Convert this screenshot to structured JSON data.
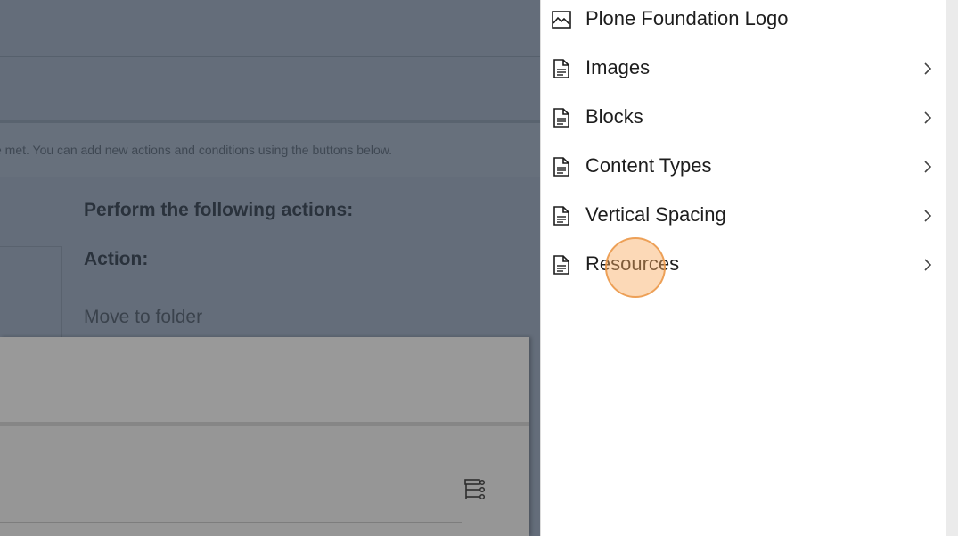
{
  "background": {
    "description_text": "e met. You can add new actions and conditions using the buttons below.",
    "heading": "Perform the following actions:",
    "action_label": "Action:",
    "action_value": "Move to folder"
  },
  "panel": {
    "items": [
      {
        "label": "Plone Foundation Logo",
        "icon": "image-icon",
        "has_children": false
      },
      {
        "label": "Images",
        "icon": "document-icon",
        "has_children": true
      },
      {
        "label": "Blocks",
        "icon": "document-icon",
        "has_children": true
      },
      {
        "label": "Content Types",
        "icon": "document-icon",
        "has_children": true
      },
      {
        "label": "Vertical Spacing",
        "icon": "document-icon",
        "has_children": true
      },
      {
        "label": "Resources",
        "icon": "document-icon",
        "has_children": true
      }
    ]
  },
  "colors": {
    "overlay": "#646d7a",
    "panel": "#ffffff",
    "click_indicator": "#f9ab60"
  }
}
